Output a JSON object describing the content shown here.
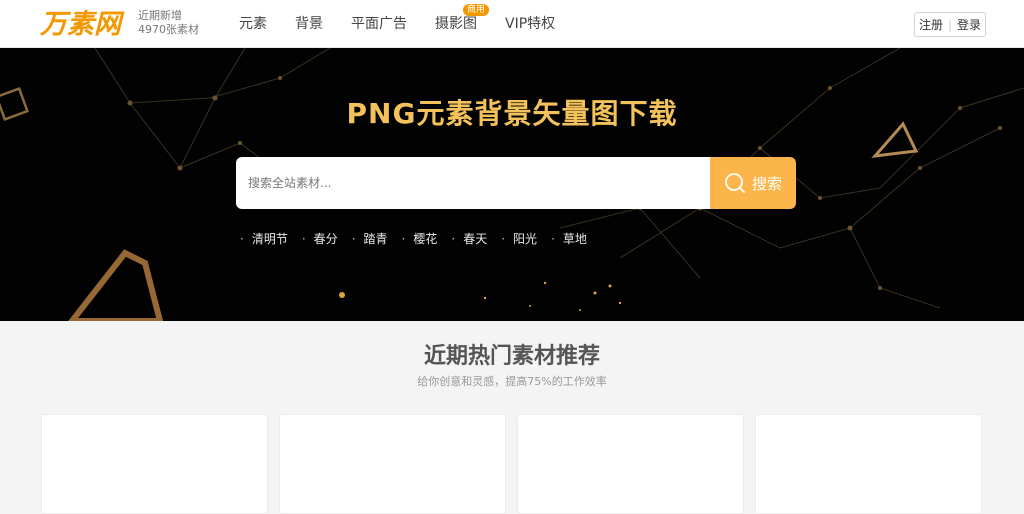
{
  "brand": {
    "logo_text": "万素网",
    "tagline_line1": "近期新增",
    "tagline_line2": "4970张素材"
  },
  "nav": {
    "items": [
      {
        "label": "元素"
      },
      {
        "label": "背景"
      },
      {
        "label": "平面广告"
      },
      {
        "label": "摄影图",
        "badge": "商用"
      },
      {
        "label": "VIP特权"
      }
    ]
  },
  "auth": {
    "register": "注册",
    "login": "登录"
  },
  "hero": {
    "title": "PNG元素背景矢量图下载",
    "search_placeholder": "搜索全站素材...",
    "search_button": "搜索",
    "hot_tags": [
      "清明节",
      "春分",
      "踏青",
      "樱花",
      "春天",
      "阳光",
      "草地"
    ]
  },
  "section": {
    "title": "近期热门素材推荐",
    "subtitle": "给你创意和灵感，提高75%的工作效率"
  },
  "colors": {
    "accent": "#fbb54b",
    "title_gold": "#f4c25a",
    "logo_orange": "#f39800"
  }
}
